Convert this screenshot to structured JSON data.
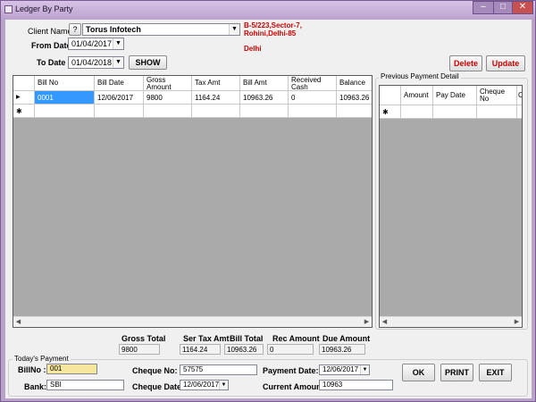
{
  "window": {
    "title": "Ledger By Party",
    "minimize_glyph": "–",
    "maximize_glyph": "□",
    "close_glyph": "✕"
  },
  "header": {
    "client_name_label": "Client Name",
    "help_glyph": "?",
    "client_value": "Torus Infotech",
    "address_line1": "B-5/223,Sector-7,",
    "address_line2": "Rohini,Delhi-85",
    "city": "Delhi",
    "from_date_label": "From Date",
    "from_date_value": "01/04/2017",
    "to_date_label": "To Date",
    "to_date_value": "01/04/2018",
    "show_label": "SHOW",
    "delete_label": "Delete",
    "update_label": "Update"
  },
  "ledger_grid": {
    "columns": [
      "Bill No",
      "Bill Date",
      "Gross Amount",
      "Tax Amt",
      "Bill Amt",
      "Received Cash",
      "Balance"
    ],
    "row": [
      "0001",
      "12/06/2017",
      "9800",
      "1164.24",
      "10963.26",
      "0",
      "10963.26"
    ],
    "row_marker": "▶",
    "new_marker": "✱"
  },
  "payment_grid": {
    "title": "Previous Payment Detail",
    "columns": [
      "Amount",
      "Pay Date",
      "Cheque No",
      "Ch"
    ],
    "new_marker": "✱"
  },
  "totals": {
    "gross_total_label": "Gross Total",
    "gross_total_value": "9800",
    "ser_tax_label": "Ser Tax Amt",
    "ser_tax_value": "1164.24",
    "bill_total_label": "Bill Total",
    "bill_total_value": "10963.26",
    "rec_amount_label": "Rec Amount",
    "rec_amount_value": "0",
    "due_amount_label": "Due Amount",
    "due_amount_value": "10963.26"
  },
  "todays_payment": {
    "title": "Today's Payment",
    "bill_no_label": "BillNo :",
    "bill_no_value": "001",
    "bank_label": "Bank:",
    "bank_value": "SBI",
    "cheque_no_label": "Cheque No:",
    "cheque_no_value": "57575",
    "cheque_date_label": "Cheque Date:",
    "cheque_date_value": "12/06/2017",
    "payment_date_label": "Payment Date:",
    "payment_date_value": "12/06/2017",
    "current_amount_label": "Current Amount :",
    "current_amount_value": "10963",
    "ok_label": "OK",
    "print_label": "PRINT",
    "exit_label": "EXIT"
  },
  "colors": {
    "accent_red": "#cc0000",
    "highlight": "#f5e79e",
    "selection": "#3399ff",
    "close_red": "#c75050"
  }
}
